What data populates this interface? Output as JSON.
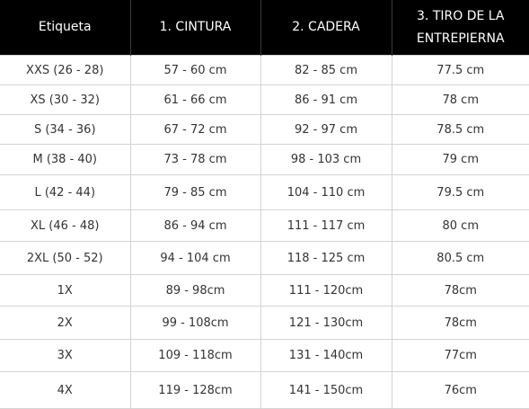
{
  "table": {
    "headers": [
      "Etiqueta",
      "1. CINTURA",
      "2. CADERA",
      "3. TIRO DE LA ENTREPIERNA"
    ],
    "rows": [
      [
        "XXS (26 - 28)",
        "57 - 60 cm",
        "82 - 85 cm",
        "77.5 cm"
      ],
      [
        "XS (30 - 32)",
        "61 - 66 cm",
        "86 - 91 cm",
        "78 cm"
      ],
      [
        "S (34 - 36)",
        "67 - 72 cm",
        "92 - 97 cm",
        "78.5 cm"
      ],
      [
        "M (38 - 40)",
        "73 - 78 cm",
        "98 - 103 cm",
        "79 cm"
      ],
      [
        "L (42 - 44)",
        "79 - 85 cm",
        "104 - 110 cm",
        "79.5 cm"
      ],
      [
        "XL (46 - 48)",
        "86 - 94 cm",
        "111 - 117 cm",
        "80 cm"
      ],
      [
        "2XL (50 - 52)",
        "94 - 104 cm",
        "118 - 125 cm",
        "80.5 cm"
      ],
      [
        "1X",
        "89 - 98cm",
        "111 - 120cm",
        "78cm"
      ],
      [
        "2X",
        "99 - 108cm",
        "121 - 130cm",
        "78cm"
      ],
      [
        "3X",
        "109 - 118cm",
        "131 - 140cm",
        "77cm"
      ],
      [
        "4X",
        "119 - 128cm",
        "141 - 150cm",
        "76cm"
      ]
    ]
  },
  "colors": {
    "header_bg": "#000000",
    "header_text": "#ffffff",
    "body_text": "#333333",
    "grid_line": "#d4d4d4"
  }
}
